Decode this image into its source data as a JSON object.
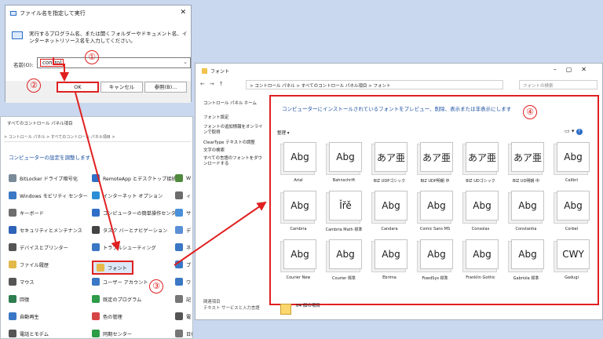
{
  "run_dialog": {
    "title": "ファイル名を指定して実行",
    "description": "実行するプログラム名、または開くフォルダーやドキュメント名、インターネットリソース名を入力してください。",
    "name_label": "名前(O):",
    "name_value": "control",
    "ok_label": "OK",
    "cancel_label": "キャンセル",
    "browse_label": "参照(B)..."
  },
  "control_panel": {
    "title": "すべてのコントロール パネル項目",
    "address": "> コントロール パネル > すべてのコントロール パネル項目 >",
    "heading": "コンピューターの設定を調整します",
    "items": [
      {
        "label": "BitLocker ドライブ暗号化",
        "color": "#7a8a99"
      },
      {
        "label": "RemoteApp とデスクトップ接続",
        "color": "#2f6fc7"
      },
      {
        "label": "W",
        "color": "#4f8a3c"
      },
      {
        "label": "Windows モビリティ センター",
        "color": "#3a78c5"
      },
      {
        "label": "インターネット オプション",
        "color": "#2b8dd6"
      },
      {
        "label": "ィ",
        "color": "#6c6c6c"
      },
      {
        "label": "キーボード",
        "color": "#6d6d6d"
      },
      {
        "label": "コンピューターの簡単操作センター",
        "color": "#2f6fc7"
      },
      {
        "label": "サ",
        "color": "#4a90d9"
      },
      {
        "label": "セキュリティとメンテナンス",
        "color": "#2d63b8"
      },
      {
        "label": "タスク バーとナビゲーション",
        "color": "#444"
      },
      {
        "label": "デ",
        "color": "#5a8fd6"
      },
      {
        "label": "デバイスとプリンター",
        "color": "#555"
      },
      {
        "label": "トラブルシューティング",
        "color": "#3a78c5"
      },
      {
        "label": "ネ",
        "color": "#3a78c5"
      },
      {
        "label": "ファイル履歴",
        "color": "#e3b84a"
      },
      {
        "label": "フォント",
        "color": "#e6b94a"
      },
      {
        "label": "プ",
        "color": "#3a78c5"
      },
      {
        "label": "マウス",
        "color": "#555"
      },
      {
        "label": "ユーザー アカウント",
        "color": "#3a78c5"
      },
      {
        "label": "ワ",
        "color": "#3a78c5"
      },
      {
        "label": "回復",
        "color": "#2e7d4f"
      },
      {
        "label": "既定のプログラム",
        "color": "#2d9b47"
      },
      {
        "label": "記",
        "color": "#777"
      },
      {
        "label": "自動再生",
        "color": "#3a78c5"
      },
      {
        "label": "色の管理",
        "color": "#d64545"
      },
      {
        "label": "電",
        "color": "#555"
      },
      {
        "label": "電話とモデム",
        "color": "#555"
      },
      {
        "label": "同期センター",
        "color": "#2d9b47"
      },
      {
        "label": "日付と時刻",
        "color": "#777"
      }
    ]
  },
  "font_window": {
    "title": "フォント",
    "address": "> コントロール パネル > すべてのコントロール パネル項目 > フォント",
    "search_placeholder": "フォントの検索",
    "sidebar": [
      "コントロール パネル ホーム",
      "フォント設定",
      "フォントの追加情報をオンラインで取得",
      "ClearType テキストの調整",
      "文字の検索",
      "すべての言語のフォントをダウンロードする"
    ],
    "related_title": "関連項目",
    "related_link": "テキスト サービスと入力言語",
    "intro": "コンピューターにインストールされているフォントをプレビュー、削除、表示または非表示にします",
    "organize_label": "整理 ▾",
    "status": "84 個の項目",
    "fonts": [
      {
        "sample": "Abg",
        "name": "Arial"
      },
      {
        "sample": "Abg",
        "name": "Bahnschrift"
      },
      {
        "sample": "あア亜",
        "name": "BIZ UDPゴシック"
      },
      {
        "sample": "あア亜",
        "name": "BIZ UDP明朝 中"
      },
      {
        "sample": "あア亜",
        "name": "BIZ UDゴシック"
      },
      {
        "sample": "あア亜",
        "name": "BIZ UD明朝 中"
      },
      {
        "sample": "Abg",
        "name": "Calibri"
      },
      {
        "sample": "Abg",
        "name": "Cambria"
      },
      {
        "sample": "Ǐřě",
        "name": "Cambria Math 標準"
      },
      {
        "sample": "Abg",
        "name": "Candara"
      },
      {
        "sample": "Abg",
        "name": "Comic Sans MS"
      },
      {
        "sample": "Abg",
        "name": "Consolas"
      },
      {
        "sample": "Abg",
        "name": "Constantia"
      },
      {
        "sample": "Abg",
        "name": "Corbel"
      },
      {
        "sample": "Abg",
        "name": "Courier New"
      },
      {
        "sample": "Abg",
        "name": "Courier 標準"
      },
      {
        "sample": "Abg",
        "name": "Ebrima"
      },
      {
        "sample": "Abg",
        "name": "FixedSys 標準"
      },
      {
        "sample": "Abg",
        "name": "Franklin Gothic"
      },
      {
        "sample": "Abg",
        "name": "Gabriola 標準"
      },
      {
        "sample": "CWY",
        "name": "Gadugi"
      }
    ]
  },
  "steps": [
    "①",
    "②",
    "③",
    "④"
  ],
  "accent_color": "#e02020"
}
